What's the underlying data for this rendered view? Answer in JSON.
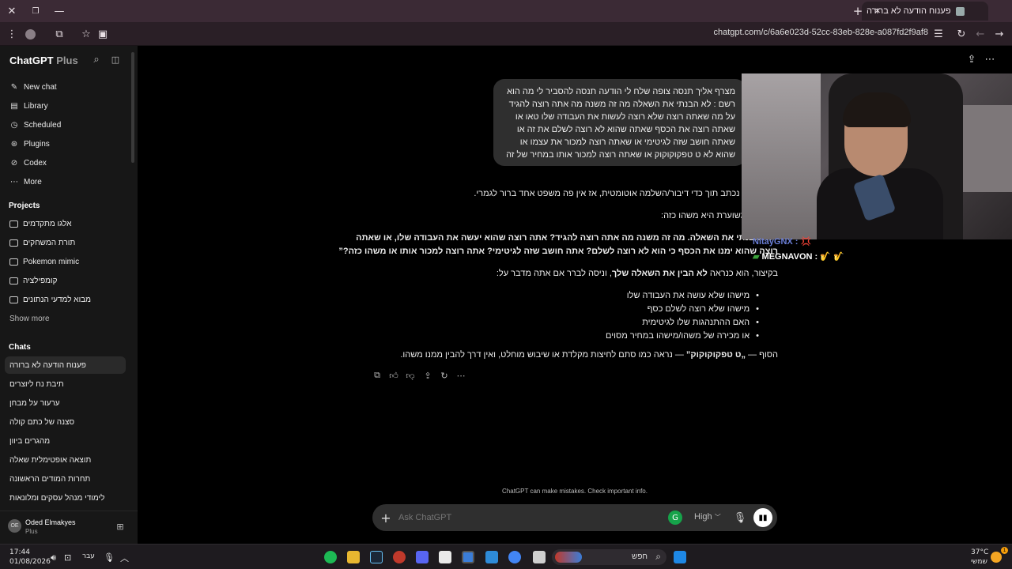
{
  "browser": {
    "tab_title": "פענוח הודעה לא ברורה",
    "url": "chatgpt.com/c/6a6e023d-52cc-83eb-828e-a087fd2f9af8"
  },
  "sidebar": {
    "brand": "ChatGPT",
    "brand_plan": "Plus",
    "nav": [
      {
        "label": "New chat",
        "icon": "edit-icon"
      },
      {
        "label": "Library",
        "icon": "library-icon"
      },
      {
        "label": "Scheduled",
        "icon": "clock-icon"
      },
      {
        "label": "Plugins",
        "icon": "plugins-icon"
      },
      {
        "label": "Codex",
        "icon": "codex-icon"
      },
      {
        "label": "More",
        "icon": "more-icon"
      }
    ],
    "projects_heading": "Projects",
    "projects": [
      "אלגו מתקדמים",
      "תורת המשחקים",
      "Pokemon mimic",
      "קומפילציה",
      "מבוא למדעי הנתונים"
    ],
    "show_more": "Show more",
    "chats_heading": "Chats",
    "chats": [
      "פענוח הודעה לא ברורה",
      "תיבת נח ליוצרים",
      "ערעור על מבחן",
      "סצנה של כתם קולה",
      "מהגרים ביוון",
      "תוצאה אופטימלית שאלה",
      "תחרות המודים הראשונה",
      "לימודי מנהל עסקים ומלונאות"
    ],
    "user": {
      "name": "Oded Elmakyes",
      "plan": "Plus",
      "initials": "OE"
    }
  },
  "user_message": "מצרף אליך תנסה צופה שלח לי הודעה תנסה להסביר לי מה הוא רשם : לא הבנתי את השאלה מה זה משנה מה אתה רוצה להגיד על מה שאתה רוצה שלא רוצה לעשות את העבודה שלו טאו או שאתה רוצה את הכסף שאתה שהוא לא רוצה לשלם את זה או שאתה חושב שזה לגיטימי או שאתה רוצה למכור את עצמו או שהוא לא ט טפקוקוקוק או שאתה רוצה למכור אותו במחיר של זה",
  "assistant": {
    "p1": "נראה שזה נכתב תוך כדי דיבור/השלמה אוטומטית, אז אין פה משפט אחד ברור לגמרי.",
    "p2": "הכוונה המשוערת היא משהו כזה:",
    "quote1": "“לא הבנתי את השאלה. מה זה משנה מה אתה רוצה להגיד? אתה רוצה שהוא יעשה את העבודה שלו, או שאתה",
    "quote2": "רוצה שהוא ימנו את הכסף כי הוא לא רוצה לשלם? אתה חושב שזה לגיטימי? אתה רוצה למכור אותו או משהו כזה?”",
    "p3_pre": "בקיצור, הוא כנראה ",
    "p3_bold": "לא הבין את השאלה שלך",
    "p3_post": ", וניסה לברר אם אתה מדבר על:",
    "bullets": [
      "מישהו שלא עושה את העבודה שלו",
      "מישהו שלא רוצה לשלם כסף",
      "האם ההתנהגות שלו לגיטימית",
      "או מכירה של משהו/מישהו במחיר מסוים"
    ],
    "p4_pre": "הסוף — ",
    "p4_bold": "„ט טפקוקוקוק”",
    "p4_post": " — נראה כמו סתם לחיצות מקלדת או שיבוש מוחלט, ואין דרך להבין ממנו משהו."
  },
  "stream_chat": [
    {
      "user": "NitayGNX :",
      "emoji": "💢"
    },
    {
      "user": "MEGNAVON :",
      "emoji": "🎷 🎷"
    }
  ],
  "disclaimer": "ChatGPT can make mistakes. Check important info.",
  "composer": {
    "placeholder": "Ask ChatGPT",
    "model": "High"
  },
  "taskbar": {
    "time": "17:44",
    "date": "01/08/2026",
    "lang": "עבר",
    "search": "חפש",
    "weather_temp": "37°C",
    "weather_desc": "שמשי",
    "notification_count": "1"
  }
}
